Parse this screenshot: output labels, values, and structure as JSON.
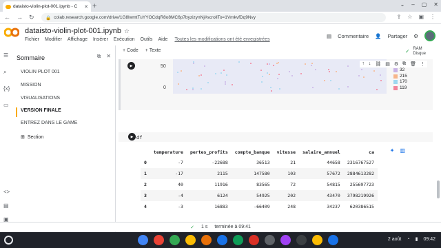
{
  "browser": {
    "tab_title": "dataisto-violin-plot-001.ipynb - C",
    "new_tab": "+",
    "url": "colab.research.google.com/drive/1G8lwmtTuYYOCdqR8o8MC6p7byzizynNj#scrollTo=1VmkvfDq9Nvy"
  },
  "colab": {
    "logo": "CO",
    "notebook_title": "dataisto-violin-plot-001.ipynb",
    "menu": [
      "Fichier",
      "Modifier",
      "Affichage",
      "Insérer",
      "Exécution",
      "Outils",
      "Aide"
    ],
    "saved_status": "Toutes les modifications ont été enregistrées",
    "comment_label": "Commentaire",
    "share_label": "Partager",
    "ram_label": "RAM",
    "disk_label": "Disque"
  },
  "sidebar": {
    "title": "Sommaire",
    "items": [
      {
        "label": "VIOLIN PLOT 001"
      },
      {
        "label": "MISSION"
      },
      {
        "label": "VISUALISATIONS"
      },
      {
        "label": "VERSION FINALE"
      },
      {
        "label": "ENTREZ DANS LE GAME"
      }
    ],
    "section_label": "Section"
  },
  "toolbar": {
    "add_code": "+ Code",
    "add_text": "+ Texte"
  },
  "plot": {
    "y_ticks": [
      "50",
      "0"
    ],
    "legend": [
      {
        "label": "32",
        "color": "#c9b3e6"
      },
      {
        "label": "215",
        "color": "#f7b58a"
      },
      {
        "label": "170",
        "color": "#9ed8f0"
      },
      {
        "label": "119",
        "color": "#f2849a"
      }
    ]
  },
  "cell2": {
    "code": "df"
  },
  "table": {
    "columns": [
      "temperature",
      "pertes_profits",
      "compte_banque",
      "vitesse",
      "salaire_annuel",
      "ca"
    ],
    "rows": [
      {
        "index": "0",
        "values": [
          "-7",
          "-22688",
          "36513",
          "21",
          "44658",
          "2316767527"
        ]
      },
      {
        "index": "1",
        "values": [
          "-17",
          "2115",
          "147580",
          "103",
          "57672",
          "2884613282"
        ]
      },
      {
        "index": "2",
        "values": [
          "40",
          "11916",
          "83565",
          "72",
          "54815",
          "255697723"
        ]
      },
      {
        "index": "3",
        "values": [
          "-4",
          "6124",
          "54925",
          "202",
          "43470",
          "3798219926"
        ]
      },
      {
        "index": "4",
        "values": [
          "-3",
          "16883",
          "-66409",
          "248",
          "34237",
          "620386515"
        ]
      }
    ]
  },
  "status": {
    "check": "✓",
    "duration": "1 s",
    "completed": "terminée à 09:41"
  },
  "shelf": {
    "date": "2 août",
    "time": "09:42"
  }
}
